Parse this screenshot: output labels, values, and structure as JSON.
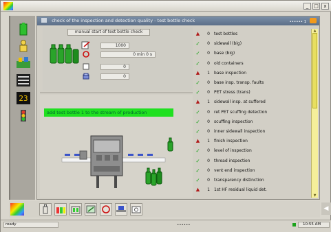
{
  "window": {
    "minimize_label": "_",
    "maximize_label": "□",
    "close_label": "x"
  },
  "header": {
    "title": "check of the inspection and detection quality - test bottle check",
    "right_text": "•••••• 1"
  },
  "test_check": {
    "button_label": "manual start of test bottle check",
    "field_count": "1000",
    "field_time": "0   min   0  s",
    "field_a": "0",
    "field_b": "0"
  },
  "message": "add test bottle 1 to the stream of production",
  "list": [
    {
      "status": "warn",
      "count": "0",
      "label": "test bottles"
    },
    {
      "status": "ok",
      "count": "0",
      "label": "sidewall (big)"
    },
    {
      "status": "ok",
      "count": "0",
      "label": "base (big)"
    },
    {
      "status": "ok",
      "count": "0",
      "label": "old containers"
    },
    {
      "status": "warn",
      "count": "1",
      "label": "base inspection"
    },
    {
      "status": "ok",
      "count": "0",
      "label": "base insp. transp. faults"
    },
    {
      "status": "ok",
      "count": "0",
      "label": "PET stress (trans)"
    },
    {
      "status": "warn",
      "count": "1",
      "label": "sidewall insp. at suffered"
    },
    {
      "status": "ok",
      "count": "0",
      "label": "ret PET scuffing detection"
    },
    {
      "status": "ok",
      "count": "0",
      "label": "scuffing inspection"
    },
    {
      "status": "ok",
      "count": "0",
      "label": "inner sidewall inspection"
    },
    {
      "status": "warn",
      "count": "1",
      "label": "finish inspection"
    },
    {
      "status": "ok",
      "count": "0",
      "label": "level of inspection"
    },
    {
      "status": "ok",
      "count": "0",
      "label": "thread inspection"
    },
    {
      "status": "ok",
      "count": "0",
      "label": "vent end inspection"
    },
    {
      "status": "ok",
      "count": "0",
      "label": "transparency distinction"
    },
    {
      "status": "warn",
      "count": "1",
      "label": "1st HF residual liquid det."
    }
  ],
  "status_bar": {
    "text": "ready",
    "middle": "••••••",
    "time": "10:55 AM"
  },
  "colors": {
    "ok": "#13a313",
    "warn": "#b01818",
    "message_bg": "#20e020",
    "header_bg": "#5c6f88",
    "scrollbar": "#f5ef9a"
  },
  "icons": {
    "left_toolbar": [
      "green-bottle-icon",
      "person-icon",
      "machine-status-icon",
      "list-icon",
      "counter-icon",
      "signal-lamp-icon"
    ],
    "bottom_toolbar": [
      "bottle-icon",
      "bottle-set-icon",
      "bottle-rack-icon",
      "inspection-icon",
      "reject-icon",
      "conveyor-icon",
      "camera-icon"
    ]
  }
}
